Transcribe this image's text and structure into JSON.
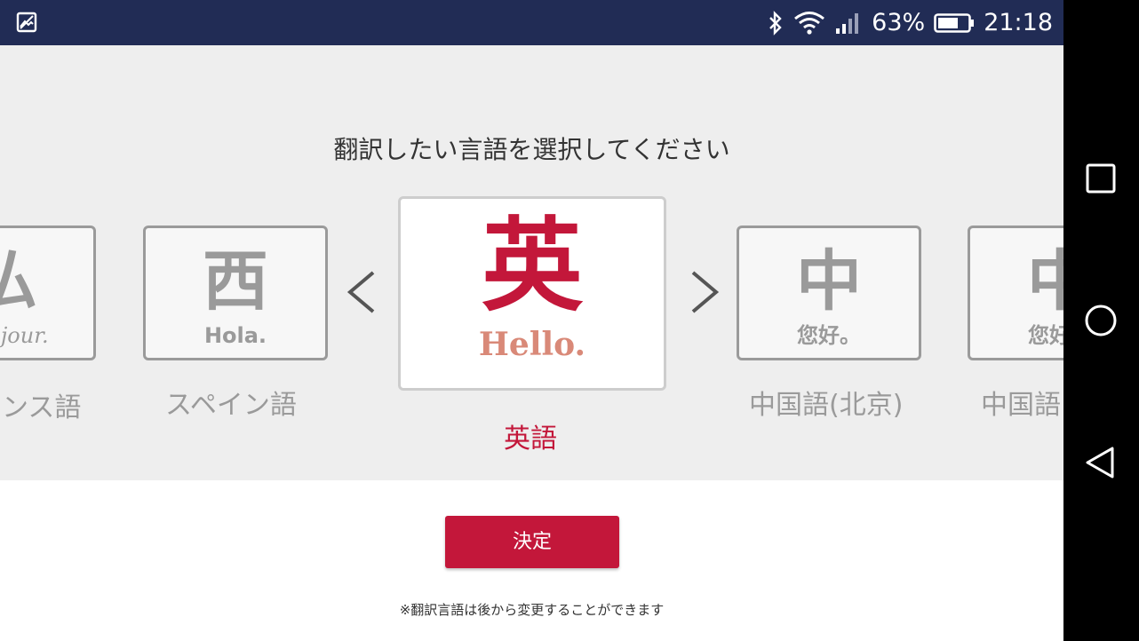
{
  "status_bar": {
    "battery": "63%",
    "time": "21:18"
  },
  "picker": {
    "prompt": "翻訳したい言語を選択してください",
    "languages": [
      {
        "kanji": "仏",
        "greeting": "Bonjour.",
        "label": "フランス語"
      },
      {
        "kanji": "西",
        "greeting": "Hola.",
        "label": "スペイン語"
      },
      {
        "kanji": "英",
        "greeting": "Hello.",
        "label": "英語"
      },
      {
        "kanji": "中",
        "greeting": "您好。",
        "label": "中国語(北京)"
      },
      {
        "kanji": "中",
        "greeting": "您好。",
        "label": "中国語"
      }
    ]
  },
  "confirm_label": "決定",
  "note": "※翻訳言語は後から変更することができます",
  "colors": {
    "accent": "#c3173a",
    "status_bar": "#212c55",
    "inactive": "#9a9a9a"
  },
  "icons": {
    "status_left": "image-icon",
    "bluetooth": "bluetooth-icon",
    "wifi": "wifi-icon",
    "signal": "signal-icon",
    "battery": "battery-icon",
    "nav_recent": "square-icon",
    "nav_home": "circle-icon",
    "nav_back": "triangle-back-icon",
    "prev": "chevron-left-icon",
    "next": "chevron-right-icon"
  }
}
